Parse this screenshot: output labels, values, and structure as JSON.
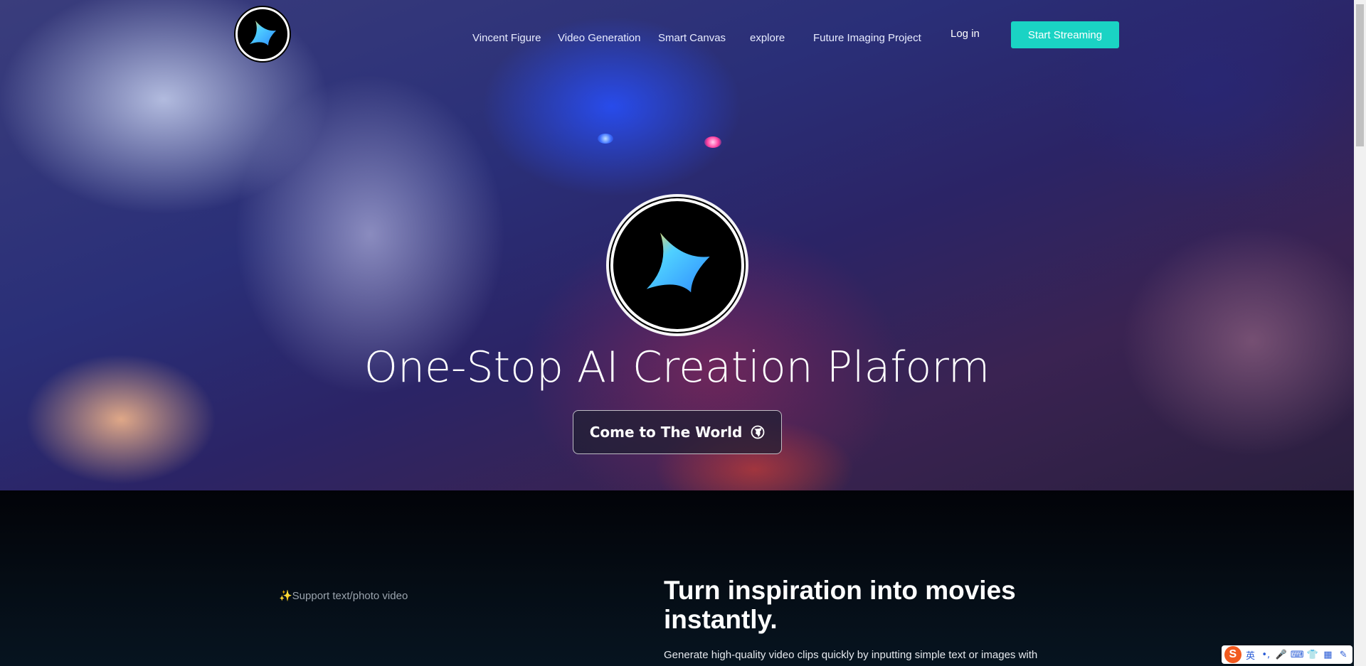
{
  "nav": {
    "links": [
      "Vincent Figure",
      "Video Generation",
      "Smart Canvas",
      "explore",
      "Future Imaging Project"
    ],
    "login_label": "Log in",
    "cta_label": "Start Streaming"
  },
  "hero": {
    "title": "One-Stop AI Creation Plaform",
    "button_label": "Come to The World"
  },
  "feature": {
    "tag": "✨Support text/photo video",
    "title": "Turn inspiration into movies instantly.",
    "description": "Generate high-quality video clips quickly by inputting simple text or images with"
  },
  "ime": {
    "logo": "S",
    "items": [
      "英",
      "•,",
      "🎤",
      "⌨",
      "👕",
      "▦",
      "✎"
    ]
  },
  "colors": {
    "accent": "#1ad3c4",
    "background": "#02060c"
  }
}
